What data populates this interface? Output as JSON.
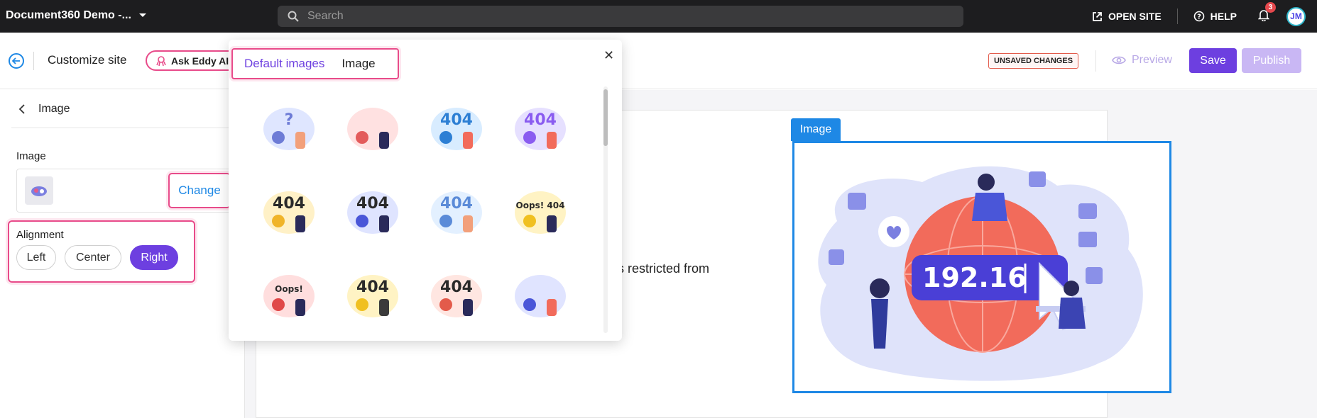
{
  "topbar": {
    "project": "Document360 Demo -...",
    "search_placeholder": "Search",
    "open_site": "OPEN SITE",
    "help": "HELP",
    "notifications": "3",
    "avatar": "JM"
  },
  "subbar": {
    "title": "Customize site",
    "ask_eddy": "Ask Eddy AI",
    "unsaved": "UNSAVED CHANGES",
    "preview": "Preview",
    "save": "Save",
    "publish": "Publish"
  },
  "left_panel": {
    "header": "Image",
    "image_label": "Image",
    "change": "Change",
    "alignment_label": "Alignment",
    "alignments": [
      "Left",
      "Center",
      "Right"
    ],
    "selected": "Right"
  },
  "canvas": {
    "page_text": "is restricted from",
    "image_tag": "Image",
    "illustration_text": "192.16"
  },
  "popup": {
    "tabs": [
      "Default images",
      "Image"
    ],
    "active_tab": "Default images",
    "thumbnails": [
      {
        "name": "question-illustration",
        "text": "?"
      },
      {
        "name": "people-illustration",
        "text": ""
      },
      {
        "name": "monitor-404",
        "text": "404"
      },
      {
        "name": "desk-404",
        "text": "404"
      },
      {
        "name": "carry-404",
        "text": "404"
      },
      {
        "name": "monster-404",
        "text": "404"
      },
      {
        "name": "team-404",
        "text": "404"
      },
      {
        "name": "robot-oops-404",
        "text": "Oops! 404"
      },
      {
        "name": "robot-oops",
        "text": "Oops!"
      },
      {
        "name": "mountain-404",
        "text": "404"
      },
      {
        "name": "people-holding-404",
        "text": "404"
      },
      {
        "name": "shield-illustration",
        "text": ""
      }
    ]
  }
}
